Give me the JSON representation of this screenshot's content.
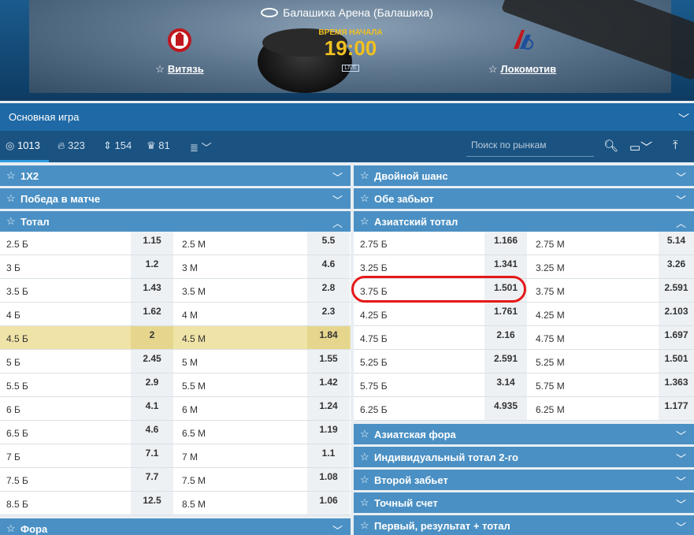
{
  "venue": "Балашиха Арена (Балашиха)",
  "home_team": "Витязь",
  "away_team": "Локомотив",
  "start": {
    "label": "ВРЕМЯ НАЧАЛА",
    "time": "19:00",
    "live": "LIVE"
  },
  "main_selector": "Основная игра",
  "filters": {
    "all": "1013",
    "hot": "323",
    "updown": "154",
    "cup": "81"
  },
  "search_placeholder": "Поиск по рынкам",
  "left_headers": [
    "1X2",
    "Победа в матче",
    "Тотал",
    "Фора"
  ],
  "right_headers_top": [
    "Двойной шанс",
    "Обе забьют",
    "Азиатский тотал"
  ],
  "right_headers_bottom": [
    "Азиатская фора",
    "Индивидуальный тотал 2-го",
    "Второй забьет",
    "Точный счет",
    "Первый, результат + тотал"
  ],
  "total_rows": [
    [
      "2.5 Б",
      "1.15",
      "2.5 М",
      "5.5"
    ],
    [
      "3 Б",
      "1.2",
      "3 М",
      "4.6"
    ],
    [
      "3.5 Б",
      "1.43",
      "3.5 М",
      "2.8"
    ],
    [
      "4 Б",
      "1.62",
      "4 М",
      "2.3"
    ],
    [
      "4.5 Б",
      "2",
      "4.5 М",
      "1.84"
    ],
    [
      "5 Б",
      "2.45",
      "5 М",
      "1.55"
    ],
    [
      "5.5 Б",
      "2.9",
      "5.5 М",
      "1.42"
    ],
    [
      "6 Б",
      "4.1",
      "6 М",
      "1.24"
    ],
    [
      "6.5 Б",
      "4.6",
      "6.5 М",
      "1.19"
    ],
    [
      "7 Б",
      "7.1",
      "7 М",
      "1.1"
    ],
    [
      "7.5 Б",
      "7.7",
      "7.5 М",
      "1.08"
    ],
    [
      "8.5 Б",
      "12.5",
      "8.5 М",
      "1.06"
    ]
  ],
  "asian_rows": [
    [
      "2.75 Б",
      "1.166",
      "2.75 М",
      "5.14"
    ],
    [
      "3.25 Б",
      "1.341",
      "3.25 М",
      "3.26"
    ],
    [
      "3.75 Б",
      "1.501",
      "3.75 М",
      "2.591"
    ],
    [
      "4.25 Б",
      "1.761",
      "4.25 М",
      "2.103"
    ],
    [
      "4.75 Б",
      "2.16",
      "4.75 М",
      "1.697"
    ],
    [
      "5.25 Б",
      "2.591",
      "5.25 М",
      "1.501"
    ],
    [
      "5.75 Б",
      "3.14",
      "5.75 М",
      "1.363"
    ],
    [
      "6.25 Б",
      "4.935",
      "6.25 М",
      "1.177"
    ]
  ],
  "colors": {
    "header": "#4a90c4",
    "highlight": "#efe3a7",
    "accent": "#f0c020",
    "circle": "#e51818"
  }
}
